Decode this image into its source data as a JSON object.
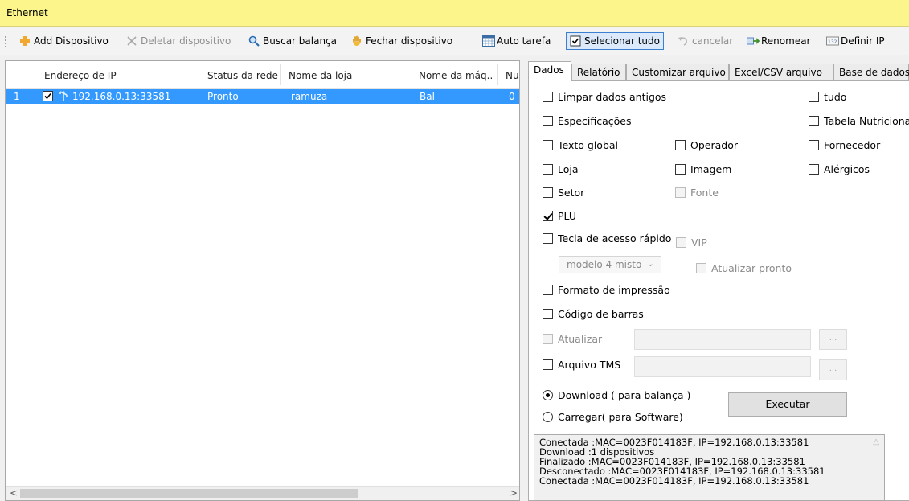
{
  "window": {
    "title": "Ethernet"
  },
  "toolbar": {
    "add": "Add Dispositivo",
    "delete": "Deletar dispositivo",
    "search": "Buscar balança",
    "close": "Fechar dispositivo",
    "auto": "Auto tarefa",
    "select_all": "Selecionar tudo",
    "cancel": "cancelar",
    "rename": "Renomear",
    "set_ip": "Definir IP"
  },
  "device_list": {
    "columns": [
      "Endereço de IP",
      "Status da rede",
      "Nome da loja",
      "Nome da máq...",
      "Nu"
    ],
    "rows": [
      {
        "index": "1",
        "ip": "192.168.0.13:33581",
        "status": "Pronto",
        "store": "ramuza",
        "machine": "Bal",
        "num": "0"
      }
    ]
  },
  "tabs": [
    "Dados",
    "Relatório",
    "Customizar arquivo",
    "Excel/CSV arquivo",
    "Base de dados"
  ],
  "options": {
    "limpar": "Limpar dados antigos",
    "tudo": "tudo",
    "especificacoes": "Especificações",
    "tabela": "Tabela Nutricional",
    "texto": "Texto global",
    "operador": "Operador",
    "fornecedor": "Fornecedor",
    "loja": "Loja",
    "imagem": "Imagem",
    "alergicos": "Alérgicos",
    "setor": "Setor",
    "fonte": "Fonte",
    "plu": "PLU",
    "tecla": "Tecla de acesso rápido",
    "vip": "VIP",
    "modelo": "modelo 4 misto",
    "atualizar_pronto": "Atualizar pronto",
    "formato": "Formato de impressão",
    "codigo": "Código de barras",
    "atualizar": "Atualizar",
    "arquivo_tms": "Arquivo TMS",
    "browse": "...",
    "download": "Download ( para balança )",
    "carregar": "Carregar( para Software)",
    "executar": "Executar"
  },
  "log": [
    "Conectada :MAC=0023F014183F, IP=192.168.0.13:33581",
    "Download :1 dispositivos",
    "Finalizado :MAC=0023F014183F, IP=192.168.0.13:33581",
    "Desconectado :MAC=0023F014183F, IP=192.168.0.13:33581",
    "Conectada :MAC=0023F014183F, IP=192.168.0.13:33581"
  ],
  "colors": {
    "titlebar": "#fbf58c",
    "selection": "#3399ff"
  },
  "icons": [
    "add-icon",
    "delete-icon",
    "search-icon",
    "hand-icon",
    "calendar-icon",
    "checkbox-icon",
    "undo-icon",
    "rename-icon",
    "ip-icon",
    "scale-icon"
  ]
}
